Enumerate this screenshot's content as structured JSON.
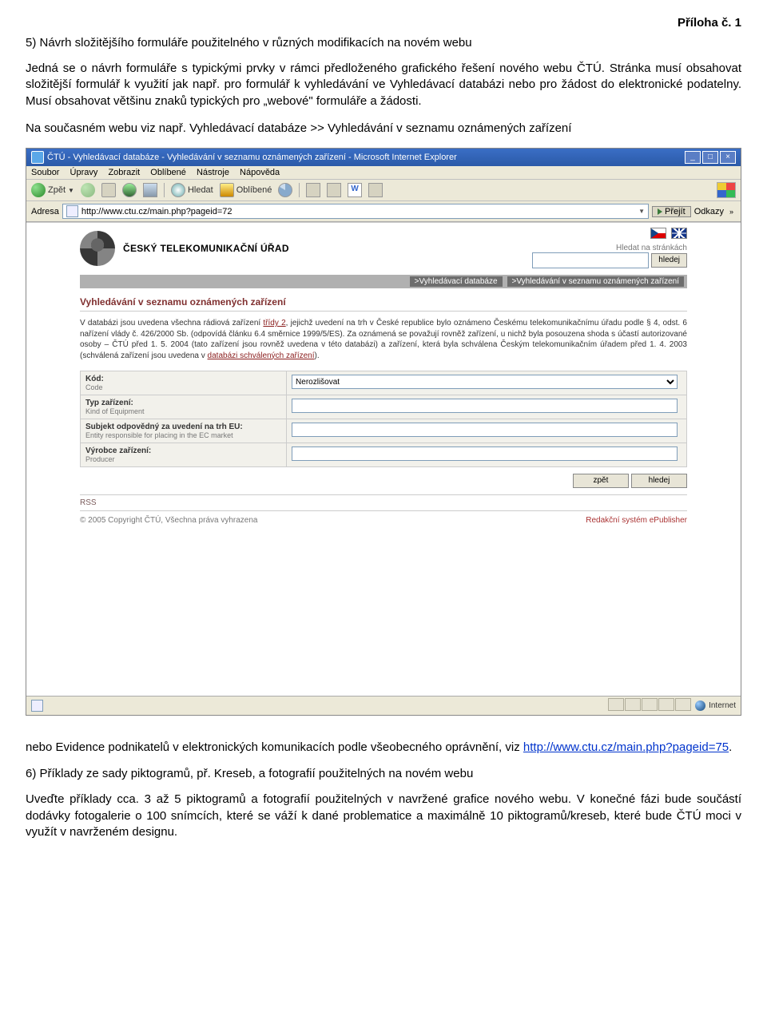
{
  "doc": {
    "attachment_label": "Příloha č. 1",
    "sec5_title": "5) Návrh složitějšího formuláře použitelného v různých modifikacích na novém webu",
    "para1": "Jedná se o návrh formuláře s typickými prvky v rámci předloženého grafického řešení nového webu ČTÚ. Stránka musí obsahovat složitější formulář k využití jak např. pro formulář k vyhledávání ve Vyhledávací databázi nebo pro žádost do elektronické podatelny. Musí obsahovat většinu znaků typických pro „webové\" formuláře a žádosti.",
    "para2_lead": "Na současném webu viz např. Vyhledávací databáze >> Vyhledávání v seznamu oznámených zařízení",
    "para3_lead": "nebo Evidence podnikatelů v elektronických komunikacích podle všeobecného oprávnění, viz ",
    "para3_link": "http://www.ctu.cz/main.php?pageid=75",
    "para3_tail": ".",
    "sec6_title": "6) Příklady ze sady piktogramů, př. Kreseb, a fotografií použitelných na novém webu",
    "para4": "Uveďte příklady cca. 3 až 5 piktogramů a fotografií použitelných v navržené grafice nového webu. V konečné fázi bude součástí dodávky fotogalerie o 100 snímcích, které se váží k dané problematice a maximálně 10 piktogramů/kreseb, které bude ČTÚ moci v využít v navrženém designu."
  },
  "browser": {
    "title": "ČTÚ - Vyhledávací databáze - Vyhledávání v seznamu oznámených zařízení - Microsoft Internet Explorer",
    "menus": [
      "Soubor",
      "Úpravy",
      "Zobrazit",
      "Oblíbené",
      "Nástroje",
      "Nápověda"
    ],
    "back": "Zpět",
    "search": "Hledat",
    "favorites": "Oblíbené",
    "addr_label": "Adresa",
    "url": "http://www.ctu.cz/main.php?pageid=72",
    "go": "Přejít",
    "links": "Odkazy",
    "win_buttons": [
      "_",
      "□",
      "×"
    ],
    "status_zone": "Internet"
  },
  "ctu": {
    "org_name": "ČESKÝ TELEKOMUNIKAČNÍ ÚŘAD",
    "search_label": "Hledat na stránkách",
    "search_button": "hledej",
    "breadcrumb": [
      ">Vyhledávací databáze",
      ">Vyhledávání v seznamu oznámených zařízení"
    ],
    "heading": "Vyhledávání v seznamu oznámených zařízení",
    "dbtext_a": "V databázi jsou uvedena všechna rádiová zařízení ",
    "dbtext_link1": "třídy 2",
    "dbtext_b": ", jejichž uvedení na trh v České republice bylo oznámeno Českému telekomunikačnímu úřadu podle § 4, odst. 6 nařízení vlády č. 426/2000 Sb. (odpovídá článku 6.4 směrnice 1999/5/ES). Za oznámená se považují rovněž zařízení, u nichž byla posouzena shoda s účastí autorizované osoby – ČTÚ před 1. 5. 2004 (tato zařízení jsou rovněž uvedena v této databázi) a zařízení, která byla schválena Českým telekomunikačním úřadem před 1. 4. 2003 (schválená zařízení jsou uvedena v ",
    "dbtext_link2": "databázi schválených zařízení",
    "dbtext_c": ").",
    "form": {
      "rows": [
        {
          "label": "Kód:",
          "sub": "Code",
          "field_type": "select",
          "value": "Nerozlišovat"
        },
        {
          "label": "Typ zařízení:",
          "sub": "Kind of Equipment",
          "field_type": "text",
          "value": ""
        },
        {
          "label": "Subjekt odpovědný za uvedení na trh EU:",
          "sub": "Entity responsible for placing in the EC market",
          "field_type": "text",
          "value": ""
        },
        {
          "label": "Výrobce zařízení:",
          "sub": "Producer",
          "field_type": "text",
          "value": ""
        }
      ],
      "btn_back": "zpět",
      "btn_search": "hledej"
    },
    "rss": "RSS",
    "copyright": "© 2005 Copyright ČTÚ, Všechna práva vyhrazena",
    "cms": "Redakční systém ePublisher"
  }
}
